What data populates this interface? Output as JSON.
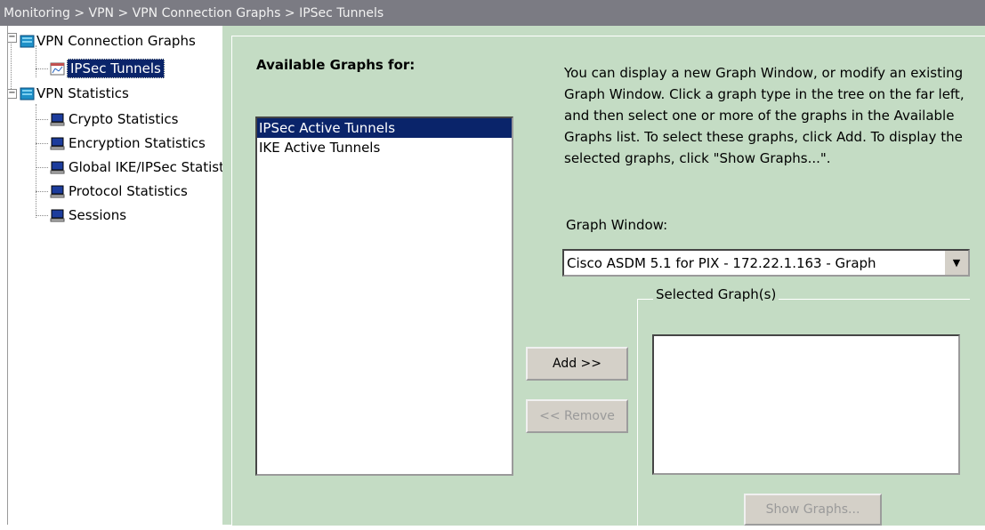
{
  "breadcrumb": "Monitoring > VPN > VPN Connection Graphs > IPSec Tunnels",
  "tree": {
    "groups": [
      {
        "label": "VPN Connection Graphs",
        "icon": "folder-icon",
        "children": [
          {
            "label": "IPSec Tunnels",
            "icon": "graph-icon",
            "selected": true
          }
        ]
      },
      {
        "label": "VPN Statistics",
        "icon": "folder-icon",
        "children": [
          {
            "label": "Crypto Statistics",
            "icon": "monitor-icon"
          },
          {
            "label": "Encryption Statistics",
            "icon": "monitor-icon"
          },
          {
            "label": "Global IKE/IPSec Statistics",
            "icon": "monitor-icon"
          },
          {
            "label": "Protocol Statistics",
            "icon": "monitor-icon"
          },
          {
            "label": "Sessions",
            "icon": "monitor-icon"
          }
        ]
      }
    ]
  },
  "available": {
    "title": "Available Graphs for:",
    "items": [
      "IPSec Active Tunnels",
      "IKE Active Tunnels"
    ],
    "selected_index": 0
  },
  "description": "You can display a new Graph Window, or modify an existing Graph Window. Click a graph type in the tree on the far left, and then select one or more of the graphs in the Available Graphs list. To select these graphs, click Add.  To display the selected graphs, click \"Show Graphs...\".",
  "graph_window": {
    "label": "Graph Window:",
    "value": "Cisco ASDM 5.1 for PIX - 172.22.1.163 - Graph"
  },
  "buttons": {
    "add": "Add >>",
    "remove": "<< Remove",
    "show_graphs": "Show Graphs..."
  },
  "selected_graphs": {
    "title": "Selected Graph(s)"
  },
  "colors": {
    "panel": "#c4dcc4",
    "selection": "#0a246a",
    "titlebar": "#7b7b83"
  }
}
